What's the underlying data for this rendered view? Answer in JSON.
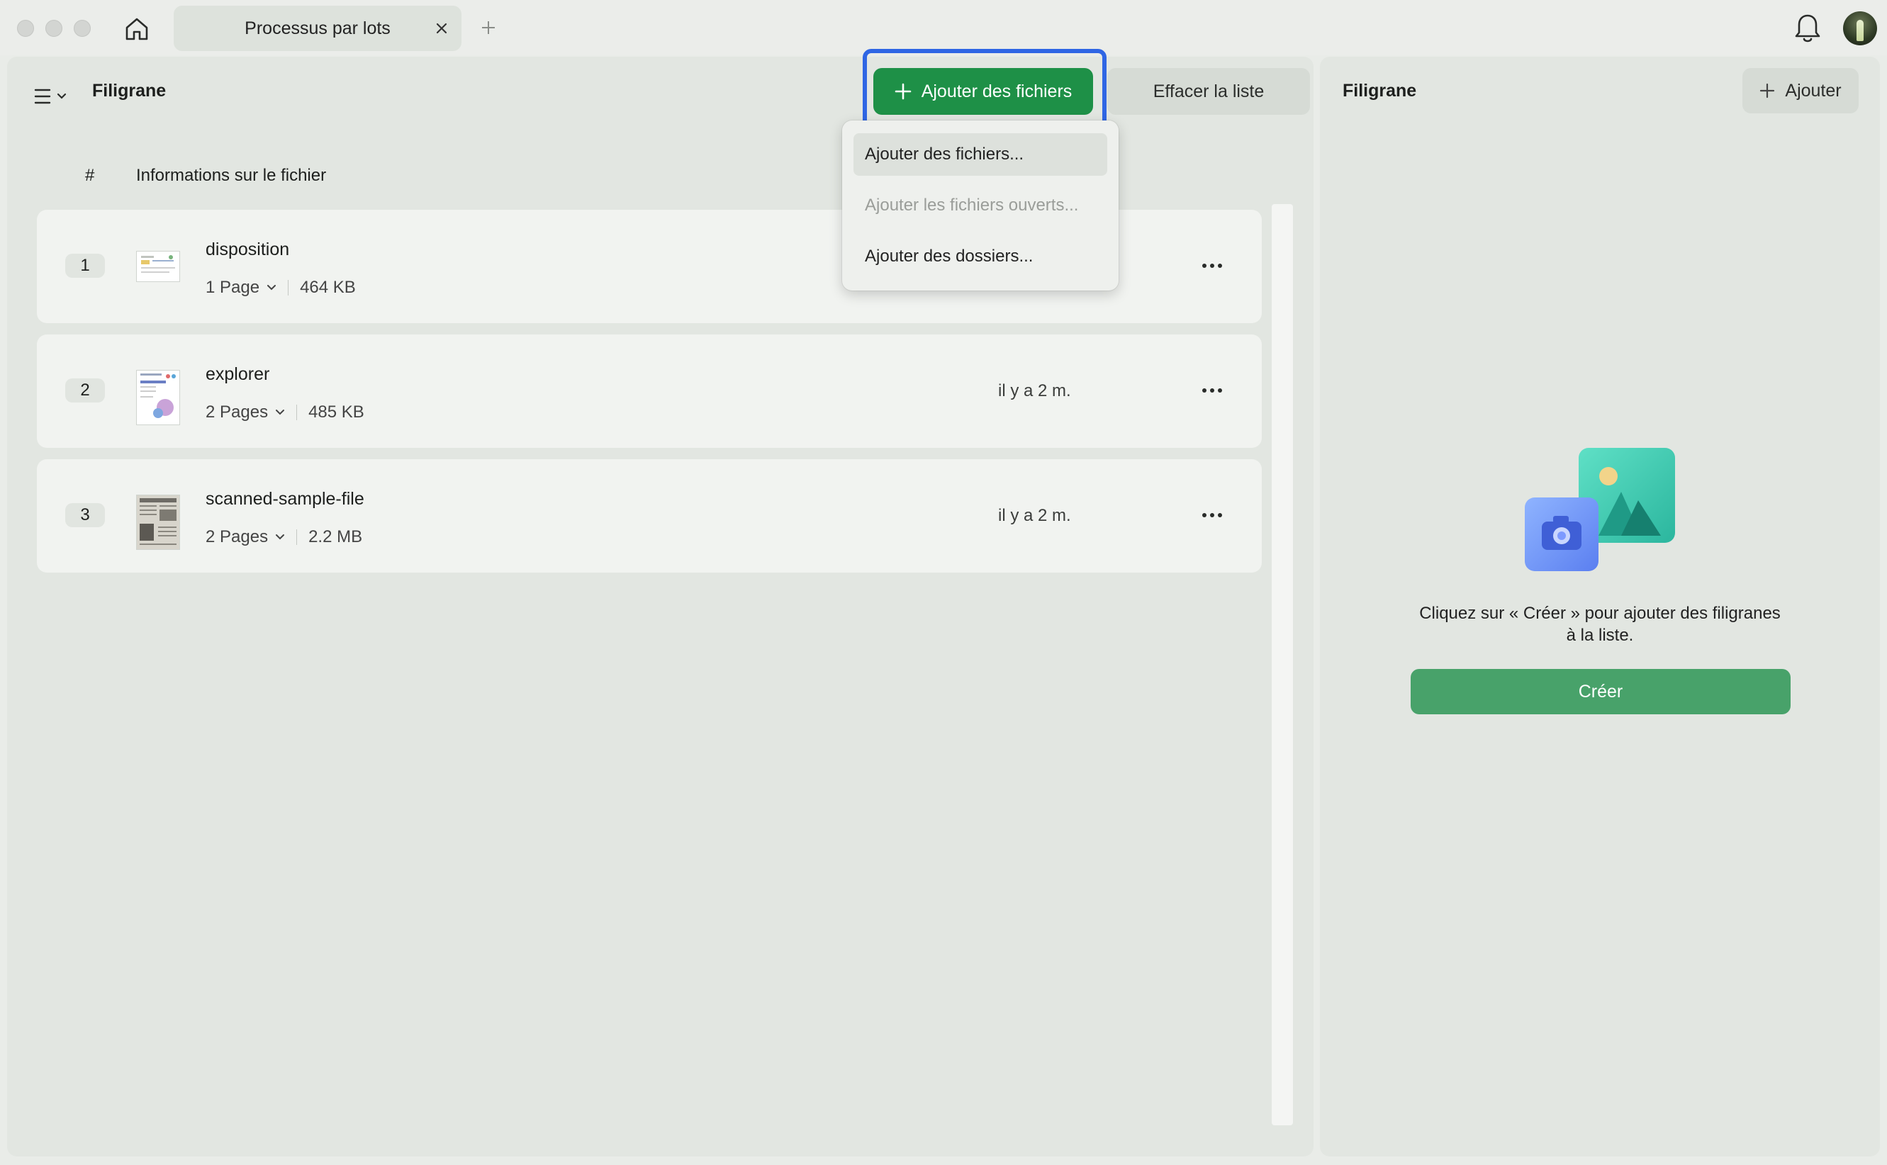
{
  "tab": {
    "title": "Processus par lots"
  },
  "main": {
    "title": "Filigrane",
    "add_files_label": "Ajouter des fichiers",
    "clear_label": "Effacer la liste",
    "columns": {
      "number": "#",
      "info": "Informations sur le fichier"
    },
    "files": [
      {
        "num": "1",
        "name": "disposition",
        "pages": "1 Page",
        "size": "464 KB",
        "time": ""
      },
      {
        "num": "2",
        "name": "explorer",
        "pages": "2 Pages",
        "size": "485 KB",
        "time": "il y a 2 m."
      },
      {
        "num": "3",
        "name": "scanned-sample-file",
        "pages": "2 Pages",
        "size": "2.2 MB",
        "time": "il y a 2 m."
      }
    ]
  },
  "dropdown": {
    "items": [
      {
        "label": "Ajouter des fichiers...",
        "state": "active"
      },
      {
        "label": "Ajouter les fichiers ouverts...",
        "state": "disabled"
      },
      {
        "label": "Ajouter des dossiers...",
        "state": "normal"
      }
    ]
  },
  "right_panel": {
    "title": "Filigrane",
    "add_label": "Ajouter",
    "empty_text": "Cliquez sur « Créer » pour ajouter des filigranes à la liste.",
    "create_label": "Créer"
  },
  "colors": {
    "primary_green": "#1e9047",
    "create_green": "#48a26a",
    "highlight_blue": "#2f66e4"
  }
}
